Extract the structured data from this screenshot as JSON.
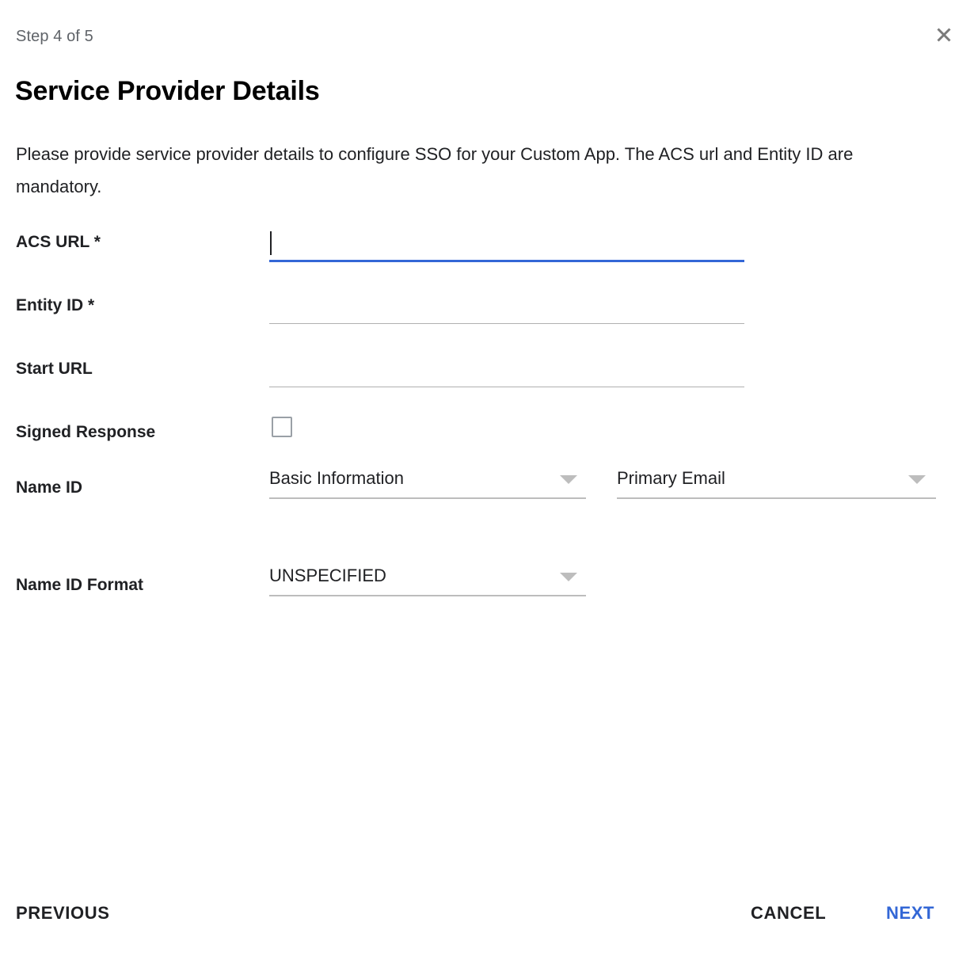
{
  "dialog": {
    "step_label": "Step 4 of 5",
    "title": "Service Provider Details",
    "description": "Please provide service provider details to configure SSO for your Custom App. The ACS url and Entity ID are mandatory.",
    "close_icon": "close-icon"
  },
  "form": {
    "fields": [
      {
        "label": "ACS URL *",
        "type": "text",
        "value": "",
        "placeholder": "",
        "focused": true,
        "required": true
      },
      {
        "label": "Entity ID *",
        "type": "text",
        "value": "",
        "placeholder": "",
        "focused": false,
        "required": true
      },
      {
        "label": "Start URL",
        "type": "text",
        "value": "",
        "placeholder": "",
        "focused": false,
        "required": false
      },
      {
        "label": "Signed Response",
        "type": "checkbox",
        "checked": false
      },
      {
        "label": "Name ID",
        "type": "select-pair",
        "primary_value": "Basic Information",
        "secondary_value": "Primary Email",
        "arrow_icon": "chevron-down-icon"
      },
      {
        "label": "Name ID Format",
        "type": "select",
        "value": "UNSPECIFIED",
        "arrow_icon": "chevron-down-icon"
      }
    ]
  },
  "footer": {
    "previous_label": "PREVIOUS",
    "cancel_label": "CANCEL",
    "next_label": "NEXT"
  },
  "colors": {
    "accent": "#3367d6",
    "text": "#202124",
    "muted": "#5f6368",
    "line": "#bdbdbd"
  }
}
